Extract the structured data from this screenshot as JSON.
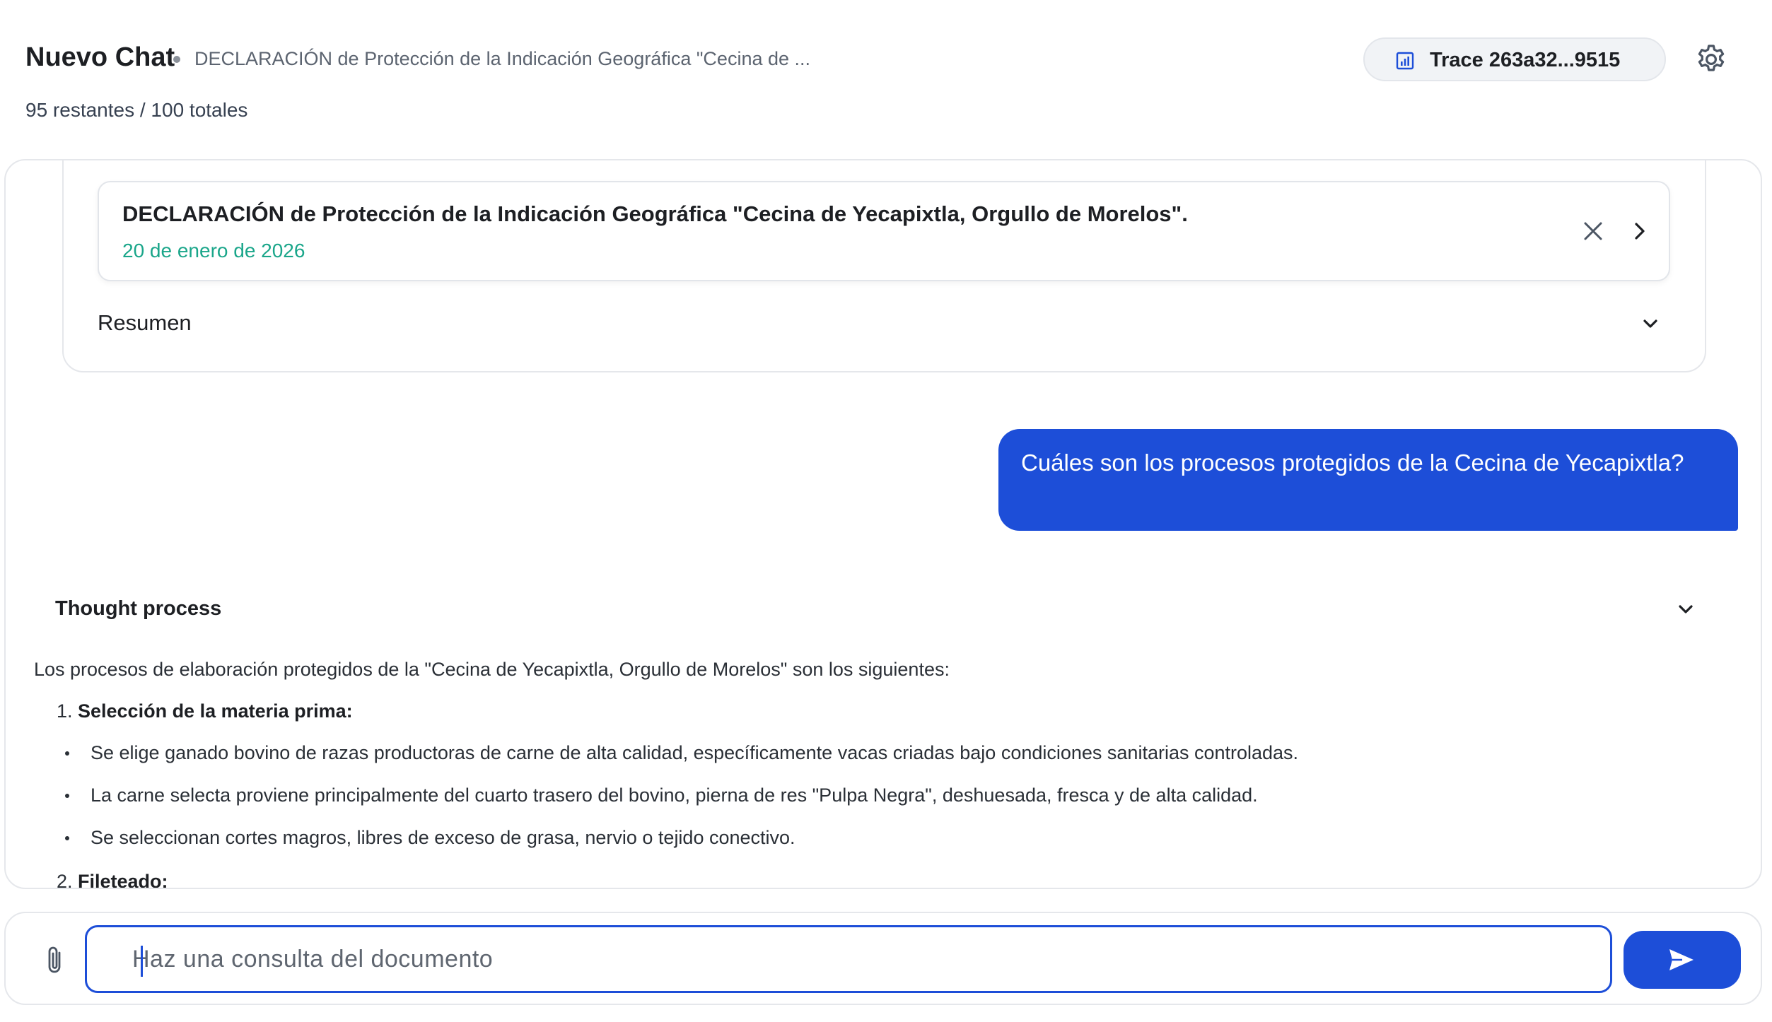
{
  "header": {
    "title": "Nuevo Chat",
    "document_name": "DECLARACIÓN de Protección de la Indicación Geográfica \"Cecina de ...",
    "remaining": "95 restantes / 100 totales",
    "trace_label": "Trace 263a32...9515",
    "trace_icon": "bar-chart-icon",
    "settings_icon": "gear-icon"
  },
  "document_card": {
    "title": "DECLARACIÓN de Protección de la Indicación Geográfica \"Cecina de Yecapixtla, Orgullo de Morelos\".",
    "date": "20 de enero de 2026",
    "summary_label": "Resumen"
  },
  "messages": {
    "user_question": "Cuáles son los procesos protegidos de la Cecina de Yecapixtla?",
    "thought_label": "Thought process",
    "answer_intro": "Los procesos de elaboración protegidos de la \"Cecina de Yecapixtla, Orgullo de Morelos\" son los siguientes:",
    "steps": [
      {
        "number": "1.",
        "title": "Selección de la materia prima:",
        "bullets": [
          "Se elige ganado bovino de razas productoras de carne de alta calidad, específicamente vacas criadas bajo condiciones sanitarias controladas.",
          "La carne selecta proviene principalmente del cuarto trasero del bovino, pierna de res \"Pulpa Negra\", deshuesada, fresca y de alta calidad.",
          "Se seleccionan cortes magros, libres de exceso de grasa, nervio o tejido conectivo."
        ]
      },
      {
        "number": "2.",
        "title": "Fileteado:"
      }
    ]
  },
  "input": {
    "placeholder": "Haz una consulta del documento",
    "value": ""
  },
  "colors": {
    "accent": "#1d4ed8",
    "date_green": "#1aa68a",
    "border": "#e5e7eb"
  }
}
